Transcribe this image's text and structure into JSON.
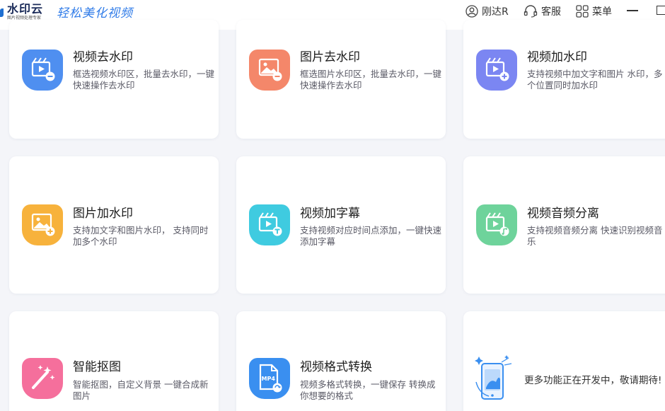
{
  "app": {
    "logo_title": "水印云",
    "logo_subtitle": "图片视频处理专家",
    "slogan": "轻松美化视频"
  },
  "titlebar": {
    "user_label": "刚达R",
    "service_label": "客服",
    "menu_label": "菜单"
  },
  "cards": [
    {
      "title": "视频去水印",
      "desc": "框选视频水印区，批量去水印，一键快速操作去水印",
      "color": "#4f8ff0",
      "icon": "video-remove-icon"
    },
    {
      "title": "图片去水印",
      "desc": "框选图片水印区，批量去水印，一键快速操作去水印",
      "color": "#f4876a",
      "icon": "image-remove-icon"
    },
    {
      "title": "视频加水印",
      "desc": "支持视频中加文字和图片 水印，多个位置同时加水印",
      "color": "#7b86f2",
      "icon": "video-add-icon"
    },
    {
      "title": "图片加水印",
      "desc": "支持加文字和图片水印， 支持同时加多个水印",
      "color": "#f7b23c",
      "icon": "image-add-icon"
    },
    {
      "title": "视频加字幕",
      "desc": "支持视频对应时间点添加，一键快速添加字幕",
      "color": "#3fcbe0",
      "icon": "video-subtitle-icon"
    },
    {
      "title": "视频音频分离",
      "desc": "支持视频音频分离 快速识别视频音乐",
      "color": "#6ed39b",
      "icon": "video-audio-icon"
    },
    {
      "title": "智能抠图",
      "desc": "智能抠图，自定义背景 一键合成新图片",
      "color": "#f56f9c",
      "icon": "smart-cutout-icon"
    },
    {
      "title": "视频格式转换",
      "desc": "视频多格式转换，一键保存 转换成你想要的格式",
      "color": "#3a8ff0",
      "icon": "video-convert-icon"
    }
  ],
  "more": {
    "desc": "更多功能正在开发中，敬请期待!"
  }
}
